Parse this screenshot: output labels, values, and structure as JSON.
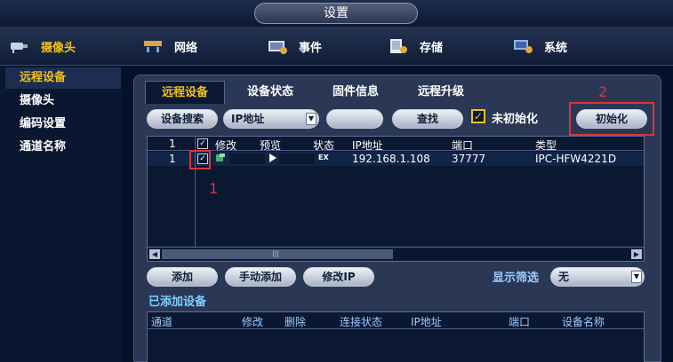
{
  "window": {
    "title": "设置"
  },
  "topnav": [
    {
      "label": "摄像头",
      "icon": "camera-icon",
      "active": true
    },
    {
      "label": "网络",
      "icon": "network-icon",
      "active": false
    },
    {
      "label": "事件",
      "icon": "event-icon",
      "active": false
    },
    {
      "label": "存储",
      "icon": "storage-icon",
      "active": false
    },
    {
      "label": "系统",
      "icon": "system-icon",
      "active": false
    }
  ],
  "sidebar": {
    "items": [
      {
        "label": "远程设备",
        "active": true
      },
      {
        "label": "摄像头",
        "active": false
      },
      {
        "label": "编码设置",
        "active": false
      },
      {
        "label": "通道名称",
        "active": false
      }
    ]
  },
  "subtabs": [
    {
      "label": "远程设备",
      "active": true
    },
    {
      "label": "设备状态",
      "active": false
    },
    {
      "label": "固件信息",
      "active": false
    },
    {
      "label": "远程升级",
      "active": false
    }
  ],
  "search_bar": {
    "search_button": "设备搜索",
    "protocol_select": "IP地址",
    "search_input": "",
    "find_button": "查找",
    "uninitialized_checked": true,
    "uninitialized_label": "未初始化",
    "init_button": "初始化"
  },
  "device_table": {
    "headers": {
      "count": "1",
      "modify": "修改",
      "preview": "预览",
      "status": "状态",
      "ip": "IP地址",
      "port": "端口",
      "type": "类型"
    },
    "header_checked": true,
    "rows": [
      {
        "num": "1",
        "checked": true,
        "status": "EX",
        "ip": "192.168.1.108",
        "port": "37777",
        "type": "IPC-HFW4221D"
      }
    ]
  },
  "actions": {
    "add": "添加",
    "manual_add": "手动添加",
    "modify_ip": "修改IP",
    "filter_label": "显示筛选",
    "filter_value": "无"
  },
  "added_devices": {
    "label": "已添加设备",
    "headers": {
      "channel": "通道",
      "modify": "修改",
      "delete": "删除",
      "connection": "连接状态",
      "ip": "IP地址",
      "port": "端口",
      "name": "设备名称"
    }
  },
  "annotations": {
    "marker1": "1",
    "marker2": "2"
  },
  "colors": {
    "accent": "#f2c01c",
    "annotation": "#e0323a",
    "panel": "#2a3856",
    "table_bg": "#0b1832"
  }
}
